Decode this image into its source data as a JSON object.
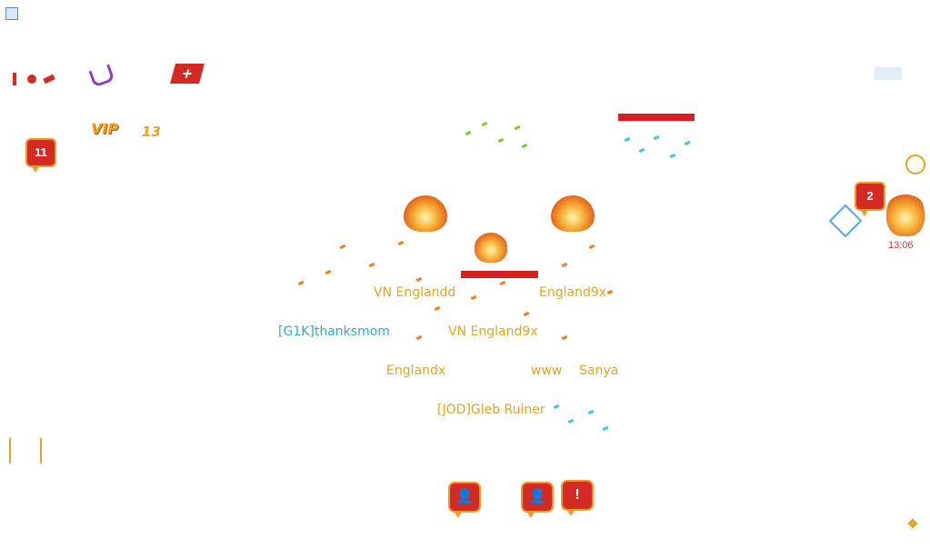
{
  "window": {
    "title": "",
    "icon": "app-window-icon"
  },
  "hud": {
    "vip_label": "VIP",
    "vip_level": "13",
    "left_badge_count": "11",
    "right_badge_count": "2",
    "clock": "13:06"
  },
  "players": [
    {
      "name": "VN Englandd",
      "color": "#e0a526"
    },
    {
      "name": "England9x",
      "color": "#e0a526"
    },
    {
      "name": "[G1K]thanksmom",
      "color": "#33a9c9"
    },
    {
      "name": "VN England9x",
      "color": "#e0a526"
    },
    {
      "name": "Englandx",
      "color": "#e0a526"
    },
    {
      "name": "www",
      "color": "#e0a526"
    },
    {
      "name": "Sanya",
      "color": "#e0a526"
    },
    {
      "name": "[JOD]Gleb Ruiner",
      "color": "#e0a526"
    }
  ],
  "actions": [
    {
      "icon": "user-icon",
      "glyph": "👤"
    },
    {
      "icon": "user-icon",
      "glyph": "👤"
    },
    {
      "icon": "alert-icon",
      "glyph": "!"
    }
  ],
  "colors": {
    "hp_bar": "#d42020",
    "badge": "#d42a24",
    "badge_border": "#f09a28"
  }
}
